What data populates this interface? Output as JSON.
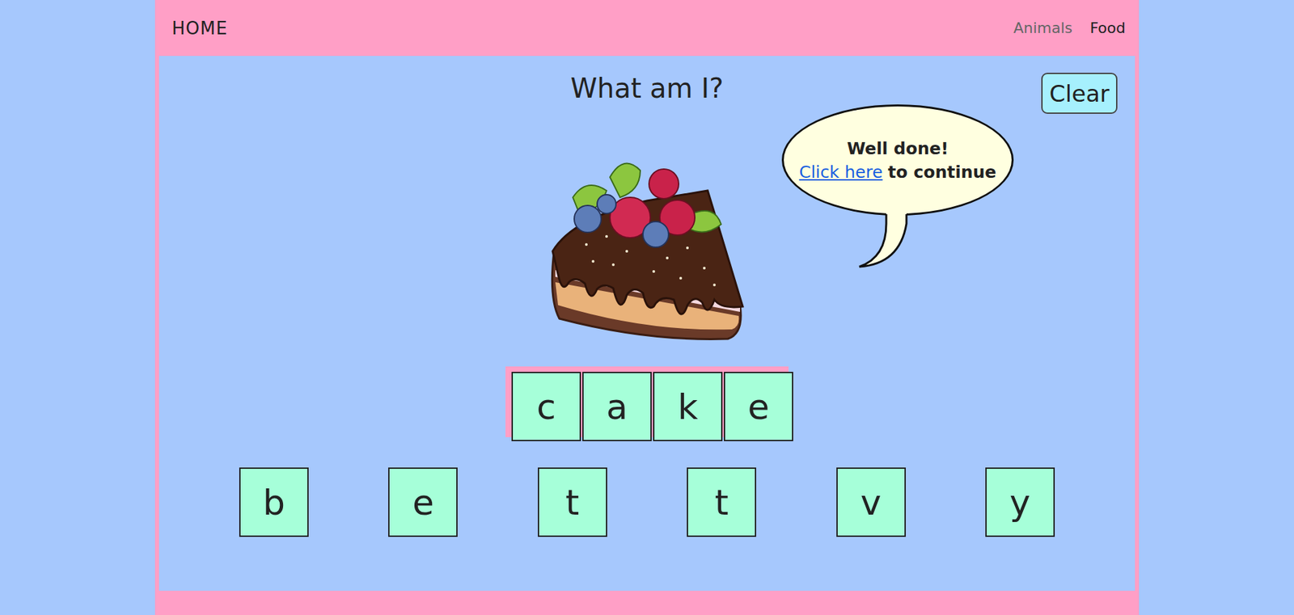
{
  "nav": {
    "home": "HOME",
    "items": [
      {
        "label": "Animals",
        "selected": false
      },
      {
        "label": "Food",
        "selected": true
      }
    ]
  },
  "title": "What am I?",
  "clear_button": "Clear",
  "bubble": {
    "heading": "Well done!",
    "link": "Click here",
    "text": "to continue"
  },
  "answer": [
    "c",
    "a",
    "k",
    "e"
  ],
  "letters": [
    "b",
    "e",
    "t",
    "t",
    "v",
    "y"
  ]
}
